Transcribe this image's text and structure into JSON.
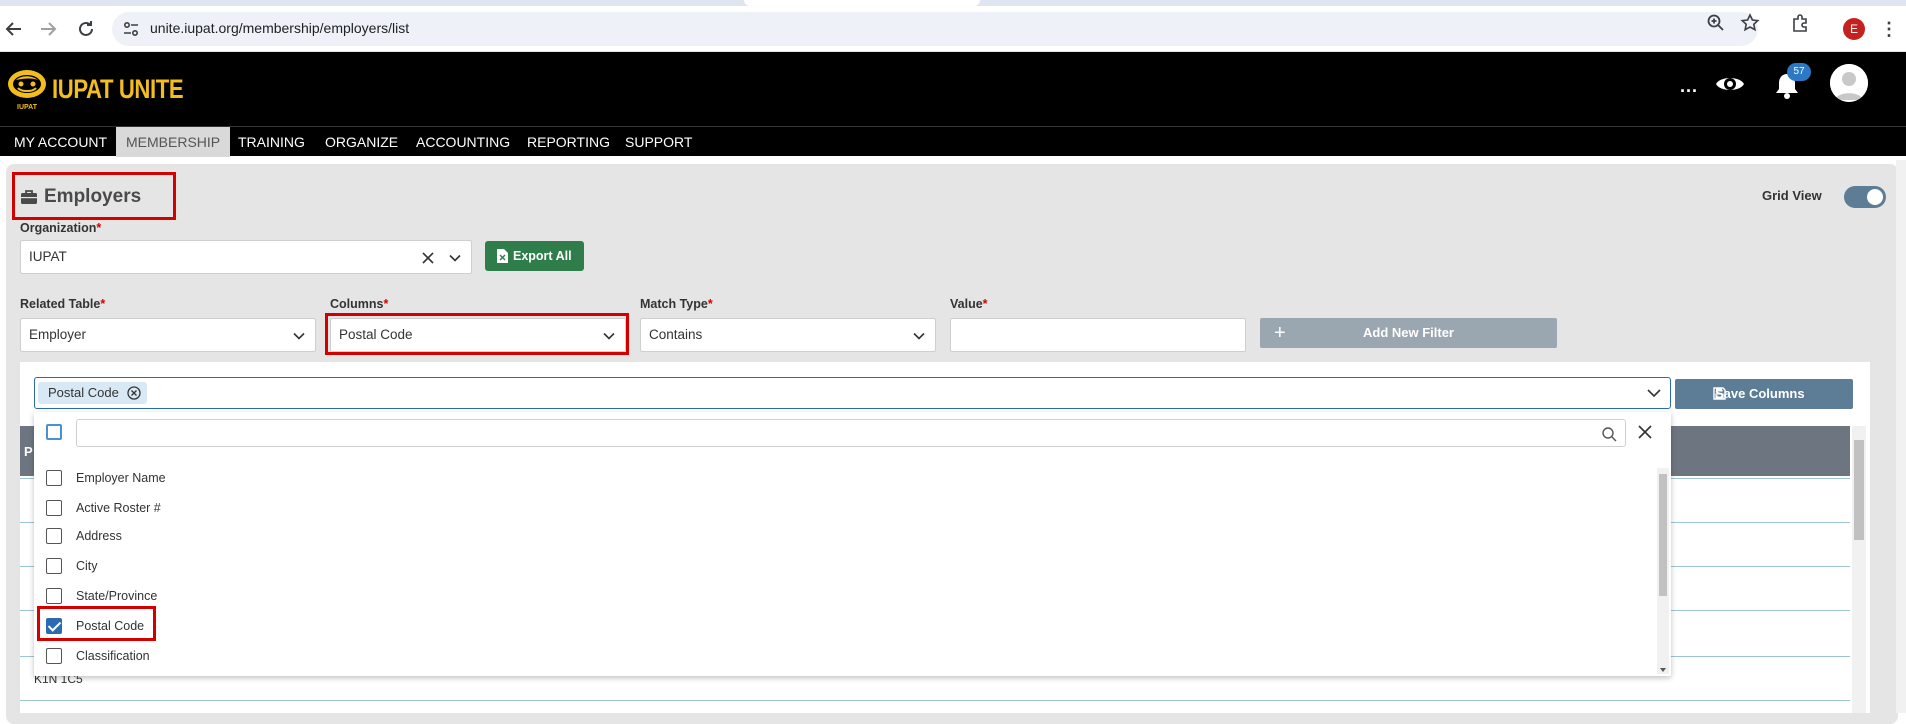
{
  "browser": {
    "url": "unite.iupat.org/membership/employers/list",
    "profile_initial": "E"
  },
  "header": {
    "logo_text": "IUPAT UNITE",
    "logo_small_text": "IUPAT",
    "more_label": "...",
    "notification_count": "57"
  },
  "menu": {
    "items": [
      "MY ACCOUNT",
      "MEMBERSHIP",
      "TRAINING",
      "ORGANIZE",
      "ACCOUNTING",
      "REPORTING",
      "SUPPORT"
    ],
    "active": "MEMBERSHIP"
  },
  "page": {
    "title": "Employers",
    "grid_view_label": "Grid View",
    "grid_view_on": true
  },
  "organization": {
    "label": "Organization",
    "required": "*",
    "value": "IUPAT"
  },
  "export_button": "Export All",
  "filters": {
    "related_table": {
      "label": "Related Table",
      "required": "*",
      "value": "Employer"
    },
    "columns": {
      "label": "Columns",
      "required": "*",
      "value": "Postal Code"
    },
    "match_type": {
      "label": "Match Type",
      "required": "*",
      "value": "Contains"
    },
    "value": {
      "label": "Value",
      "required": "*",
      "value": ""
    },
    "add_button": "Add New Filter",
    "add_icon": "+"
  },
  "column_picker": {
    "chip": "Postal Code",
    "save_button": "Save Columns",
    "search_value": "",
    "options": [
      {
        "label": "Employer Name",
        "checked": false
      },
      {
        "label": "Active Roster #",
        "checked": false
      },
      {
        "label": "Address",
        "checked": false
      },
      {
        "label": "City",
        "checked": false
      },
      {
        "label": "State/Province",
        "checked": false
      },
      {
        "label": "Postal Code",
        "checked": true
      },
      {
        "label": "Classification",
        "checked": false
      }
    ]
  },
  "grid": {
    "header_first": "P",
    "visible_cell": "K1N 1C5"
  },
  "colors": {
    "accent_blue": "#2b6cb0",
    "highlight_red": "#d40000",
    "export_green": "#2e7d4a",
    "logo_gold": "#f2bd1d"
  },
  "icons": {
    "back": "back-arrow-icon",
    "forward": "forward-arrow-icon",
    "reload": "reload-icon",
    "zoom": "zoom-icon",
    "bookmark": "star-icon",
    "extensions": "puzzle-icon",
    "eye": "eye-icon",
    "bell": "bell-icon",
    "briefcase": "briefcase-icon",
    "excel": "excel-file-icon",
    "save": "floppy-disk-icon",
    "search": "search-icon"
  }
}
